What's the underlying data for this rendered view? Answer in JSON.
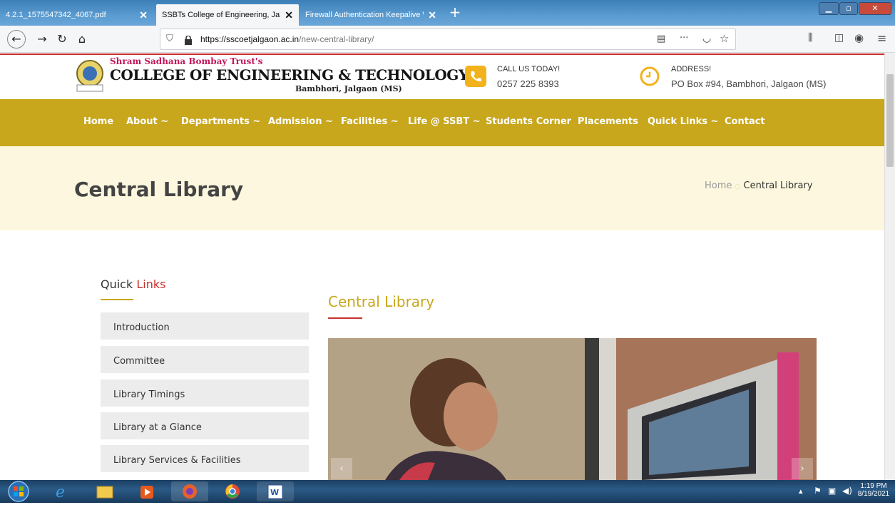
{
  "browser": {
    "tabs": [
      {
        "label": "4.2.1_1575547342_4067.pdf",
        "active": false
      },
      {
        "label": "SSBTs College of Engineering, Jalgaon",
        "active": true
      },
      {
        "label": "Firewall Authentication Keepalive Window",
        "active": false
      }
    ],
    "new_tab_label": "+",
    "tab_close_label": "✕",
    "url_host": "https://sscoetjalgaon.ac.in",
    "url_path": "/new-central-library/",
    "page_actions": "···"
  },
  "site": {
    "trust_name": "Shram Sadhana Bombay Trust's",
    "college_name": "COLLEGE OF ENGINEERING & TECHNOLOGY",
    "location": "Bambhori, Jalgaon (MS)",
    "call_label": "CALL US TODAY!",
    "call_number": "0257 225 8393",
    "address_label": "ADDRESS!",
    "address_value": "PO Box #94, Bambhori, Jalgaon (MS)",
    "menu": [
      "Home",
      "About ~",
      "Departments ~",
      "Admission ~",
      "Facilities ~",
      "Life @ SSBT ~",
      "Students Corner",
      "Placements",
      "Quick Links ~",
      "Contact"
    ],
    "page_title": "Central Library",
    "breadcrumb_home": "Home",
    "breadcrumb_sep": "○",
    "breadcrumb_current": "Central Library",
    "quick_links_heading_1": "Quick",
    "quick_links_heading_2": "Links",
    "quick_links": [
      "Introduction",
      "Committee",
      "Library Timings",
      "Library at a Glance",
      "Library Services & Facilities"
    ],
    "section_heading": "Central Library",
    "slider_prev": "‹",
    "slider_next": "›"
  },
  "taskbar": {
    "time": "1:19 PM",
    "date": "8/19/2021"
  },
  "colors": {
    "menu_bg": "#c8a71d",
    "banner_bg": "#fcf7de",
    "accent_red": "#c9302c",
    "accent_gold": "#c8a71d",
    "header_icon": "#f2b21b"
  }
}
